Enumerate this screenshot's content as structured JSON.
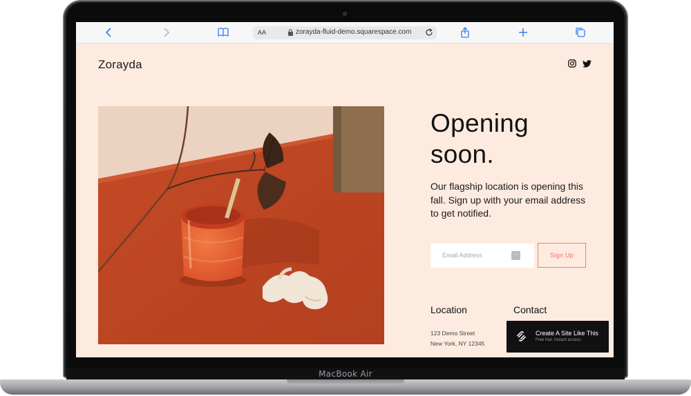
{
  "device": {
    "label": "MacBook Air"
  },
  "browser": {
    "text_size_label": "AA",
    "url": "zorayda-fluid-demo.squarespace.com",
    "icons": [
      "chevron-left-icon",
      "chevron-right-icon",
      "book-icon",
      "lock-icon",
      "reload-icon",
      "share-icon",
      "plus-icon",
      "tabs-icon"
    ]
  },
  "site": {
    "brand": "Zorayda",
    "social": [
      "instagram-icon",
      "twitter-icon"
    ],
    "headline": "Opening soon.",
    "description": "Our flagship location is opening this fall. Sign up with your email address to get notified.",
    "form": {
      "email_placeholder": "Email Address",
      "signup_label": "Sign Up"
    },
    "footer": {
      "location_heading": "Location",
      "address_line1": "123 Demo Street",
      "address_line2": "New York, NY 12345",
      "contact_heading": "Contact"
    },
    "badge": {
      "title": "Create A Site Like This",
      "subtitle": "Free trial. Instant access."
    }
  },
  "colors": {
    "page_bg": "#fdebdf",
    "accent": "#e8836f",
    "text": "#121212"
  }
}
